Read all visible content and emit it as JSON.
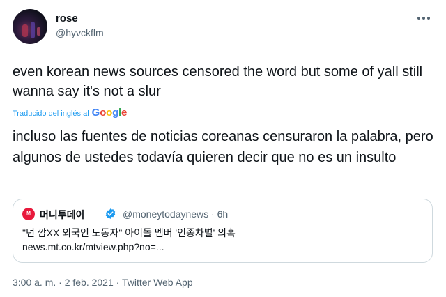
{
  "author": {
    "name": "rose",
    "handle": "@hyvckflm"
  },
  "tweet": {
    "text_original": "even korean news sources censored the word but some of yall still wanna say it's not a slur",
    "translation_label": "Traducido del inglés al",
    "translation_provider": "Google",
    "text_translated": "incluso las fuentes de noticias coreanas censuraron la palabra, pero algunos de ustedes todavía quieren decir que no es un insulto"
  },
  "quoted": {
    "avatar_text": "M",
    "name": "머니투데이",
    "handle_time": "@moneytodaynews · 6h",
    "title": "\"넌 깜XX 외국인 노동자\" 아이돌 멤버 '인종차별' 의혹",
    "link": "news.mt.co.kr/mtview.php?no=..."
  },
  "footer": {
    "timestamp": "3:00 a. m. · 2 feb. 2021 · Twitter Web App"
  },
  "icons": {
    "more": "more-icon",
    "verified": "verified-badge-icon"
  },
  "colors": {
    "accent": "#1d9bf0",
    "secondary_text": "#536471",
    "border": "#cfd9de",
    "quoted_brand": "#e8193c"
  }
}
